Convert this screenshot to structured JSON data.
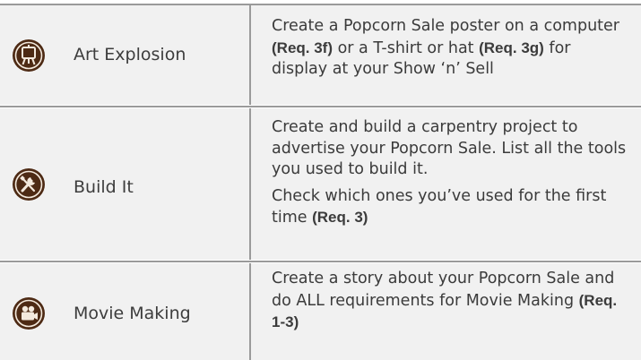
{
  "rows": [
    {
      "icon": "easel-icon",
      "name": "Art Explosion",
      "desc_a": "Create a Popcorn Sale poster on a computer ",
      "desc_b": "(Req. 3f)",
      "desc_c": " or a T-shirt or hat ",
      "desc_d": "(Req. 3g)",
      "desc_e": " for display at your Show ‘n’ Sell"
    },
    {
      "icon": "tools-icon",
      "name": "Build It",
      "desc_a": "Create and build a carpentry project to advertise your Popcorn Sale. List all the tools you used to build it.",
      "desc_b": "Check which ones you’ve used for the first time ",
      "desc_c": "(Req. 3)"
    },
    {
      "icon": "movie-camera-icon",
      "name": "Movie Making",
      "desc_a": "Create a story about your Popcorn Sale and do ALL requirements for Movie Making ",
      "desc_b": "(Req. 1-3)"
    }
  ]
}
